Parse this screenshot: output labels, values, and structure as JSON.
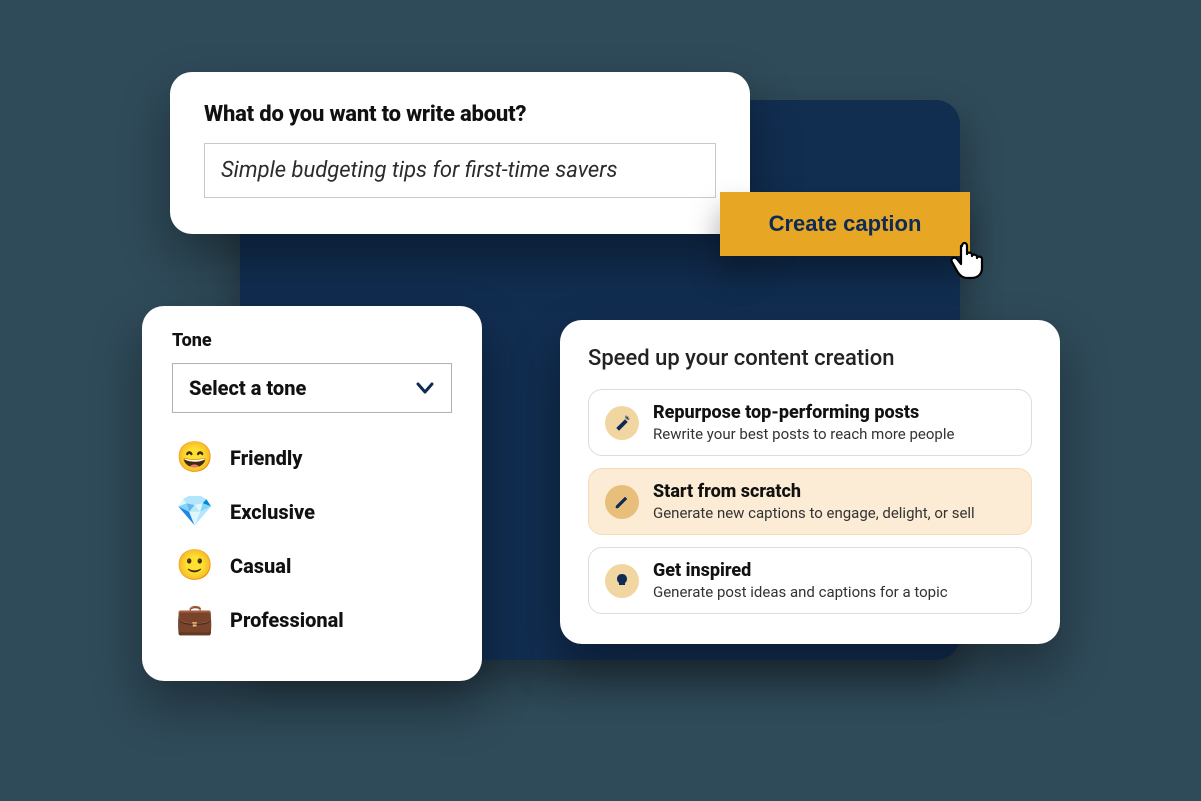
{
  "prompt": {
    "title": "What do you want to write about?",
    "value": "Simple budgeting tips for first-time savers"
  },
  "create_button": {
    "label": "Create caption"
  },
  "tone": {
    "label": "Tone",
    "placeholder": "Select a tone",
    "options": [
      {
        "emoji": "😄",
        "label": "Friendly"
      },
      {
        "emoji": "💎",
        "label": "Exclusive"
      },
      {
        "emoji": "🙂",
        "label": "Casual"
      },
      {
        "emoji": "💼",
        "label": "Professional"
      }
    ]
  },
  "speed": {
    "title": "Speed up your content creation",
    "items": [
      {
        "icon": "wand",
        "title": "Repurpose top-performing posts",
        "desc": "Rewrite your best posts to reach more people",
        "highlight": false
      },
      {
        "icon": "pencil",
        "title": "Start from scratch",
        "desc": "Generate new captions to engage, delight, or sell",
        "highlight": true
      },
      {
        "icon": "bulb",
        "title": "Get inspired",
        "desc": "Generate post ideas and captions for a topic",
        "highlight": false
      }
    ]
  },
  "colors": {
    "background": "#2f4a59",
    "panel": "#112d50",
    "accent": "#e7a624",
    "accent_text": "#0d2b55"
  }
}
